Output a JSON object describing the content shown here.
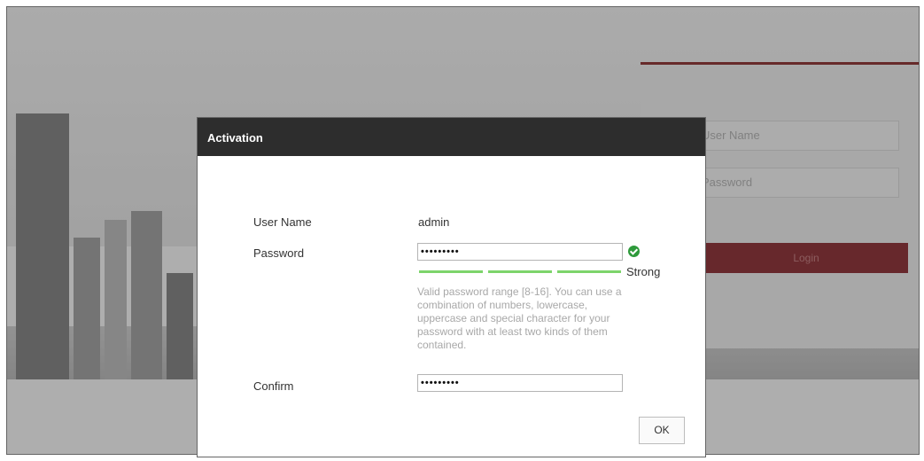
{
  "login": {
    "username_placeholder": "User Name",
    "password_placeholder": "Password",
    "login_label": "Login"
  },
  "activation": {
    "title": "Activation",
    "username_label": "User Name",
    "username_value": "admin",
    "password_label": "Password",
    "password_value": "•••••••••",
    "strength_label": "Strong",
    "strength_level": 3,
    "strength_max": 3,
    "hint": "Valid password range [8-16]. You can use a combination of numbers, lowercase, uppercase and special character for your password with at least two kinds of them contained.",
    "confirm_label": "Confirm",
    "confirm_value": "•••••••••",
    "ok_label": "OK"
  },
  "colors": {
    "header_bg": "#2d2d2d",
    "strength_bar": "#7dd46b",
    "valid_check": "#2e9a3b",
    "login_button": "#7a1a1f"
  },
  "icons": {
    "valid": "check-circle-icon"
  }
}
